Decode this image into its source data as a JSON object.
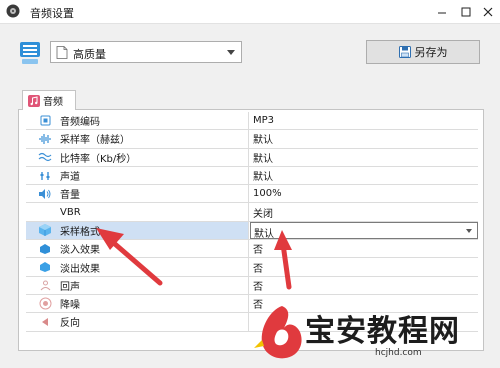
{
  "window": {
    "title": "音频设置"
  },
  "toolbar": {
    "preset_value": "高质量",
    "saveas_label": "另存为"
  },
  "tab": {
    "label": "音频"
  },
  "rows": [
    {
      "label": "音频编码",
      "value": "MP3",
      "icon": "chip-icon"
    },
    {
      "label": "采样率（赫兹）",
      "value": "默认",
      "icon": "waveform-icon"
    },
    {
      "label": "比特率（Kb/秒）",
      "value": "默认",
      "icon": "wave-icon"
    },
    {
      "label": "声道",
      "value": "默认",
      "icon": "channel-icon"
    },
    {
      "label": "音量",
      "value": "100%",
      "icon": "volume-icon"
    },
    {
      "label": "VBR",
      "value": "关闭",
      "icon": "vbr-icon"
    },
    {
      "label": "采样格式",
      "value": "默认",
      "icon": "cube-icon"
    },
    {
      "label": "淡入效果",
      "value": "否",
      "icon": "fade-in-icon"
    },
    {
      "label": "淡出效果",
      "value": "否",
      "icon": "fade-out-icon"
    },
    {
      "label": "回声",
      "value": "否",
      "icon": "echo-icon"
    },
    {
      "label": "降噪",
      "value": "否",
      "icon": "denoise-icon"
    },
    {
      "label": "反向",
      "value": "",
      "icon": "reverse-icon"
    }
  ],
  "watermark": {
    "text": "宝安教程网",
    "url": "hcjhd.com"
  },
  "colors": {
    "accent_red": "#e03a3e",
    "selected_row": "#cfe0f4",
    "icon_blue": "#2f8fd8"
  }
}
